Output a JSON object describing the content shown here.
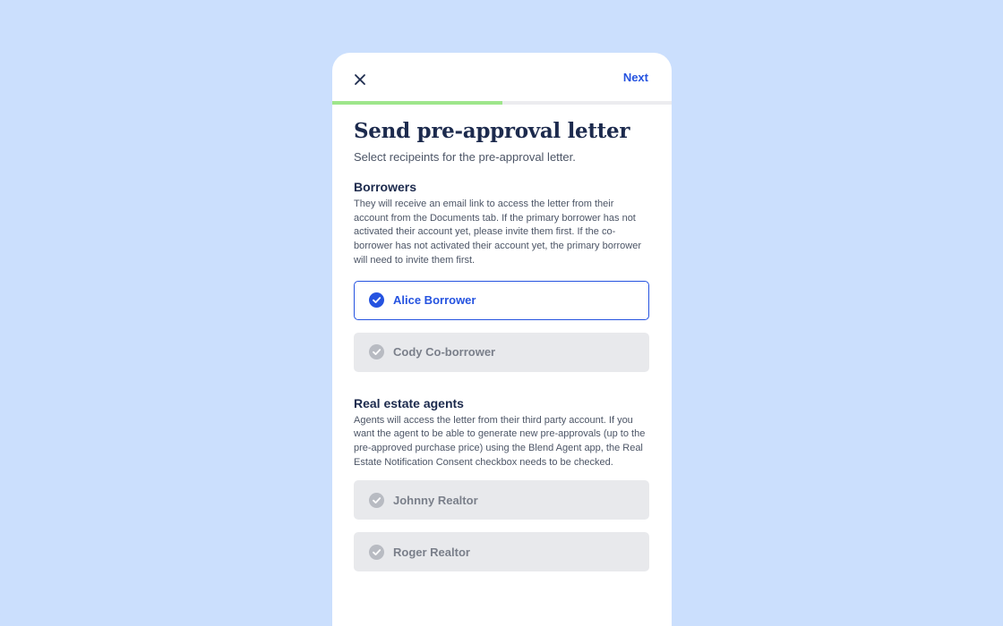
{
  "header": {
    "next_label": "Next",
    "progress_fraction": 0.5
  },
  "main": {
    "title": "Send pre-approval letter",
    "subtitle": "Select recipeints for the pre-approval letter."
  },
  "borrowers": {
    "heading": "Borrowers",
    "description": "They will receive an email link to access the letter from their account from the Documents tab. If the primary borrower has not activated their account yet, please invite them first. If the co-borrower has not activated their account yet, the primary borrower will need to invite them first.",
    "options": [
      {
        "label": "Alice Borrower",
        "selected": true
      },
      {
        "label": "Cody Co-borrower",
        "selected": false
      }
    ]
  },
  "agents": {
    "heading": "Real estate agents",
    "description": "Agents will access the letter from their third party account. If you want the agent to be able to generate new pre-approvals (up to the pre-approved purchase price) using the Blend Agent app, the Real Estate Notification Consent checkbox needs to be checked.",
    "options": [
      {
        "label": "Johnny Realtor",
        "selected": false
      },
      {
        "label": "Roger Realtor",
        "selected": false
      }
    ]
  },
  "icons": {
    "close": "close-icon",
    "check": "check-circle-icon"
  },
  "colors": {
    "background": "#cbdffd",
    "accent": "#2553e0",
    "progress": "#9ee68b",
    "title": "#1c2a4d",
    "option_disabled_bg": "#e8e9ec",
    "check_inactive": "#b8bbc2"
  }
}
